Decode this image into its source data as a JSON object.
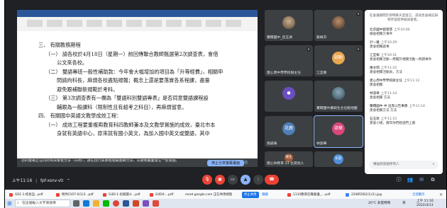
{
  "presentation": {
    "doc_lines": [
      "三、 有關教務期程",
      "（一） 請各校於4月18日（星期一）前回傳聯合教師甄選第2次調查表，會借",
      "公文來各校。",
      "（二） 雙語專班一般性補助款：今年會大幅增加的項目為「升等經費」，相關申",
      "問請向科長，麻煩各校盡點規報；概念上還是要落實各系程課，盡量",
      "避免跟補聯新規範於考科。",
      "（三） 第3次調查表有一欄為「雙語科別雙語專表」是否同意雙語課程設",
      "輔跟為一般課科（限制性且有超考之科目），再麻煩留意。",
      "四、 有關國中英語文教學成效工程：",
      "（一） 成效工程要重複兩教育科四教師兼本及文教學實施的成效，臺北市本",
      "身就有英語中心，原來就有國小英文，為加入國中英文或雙語，其中"
    ],
    "share_message": "您的螢幕正在向所有與會者分享（共用），請在自行與會者隱藏螢幕分享，以避免畫面發生一些漫遊。",
    "stop_sharing_label": "停止分享螢幕畫面",
    "hide_label": "略過"
  },
  "tiles": [
    {
      "name": "實踐國中_呂玉清",
      "kind": "photo",
      "color": "#5a6b4f"
    },
    {
      "name": "蔡綺芬",
      "kind": "photo",
      "color": "#6b4f3b"
    },
    {
      "name": "",
      "kind": "photo",
      "color": "#4c6a7a"
    },
    {
      "name": "建心周中學學校辦主任",
      "kind": "dark",
      "color": "#3c4043"
    },
    {
      "name": "江宜鄰",
      "kind": "avatar",
      "avatar": "啟動",
      "color": "#e8a64f"
    },
    {
      "name": "林誠佩",
      "kind": "photo",
      "color": "#7a5a4a"
    },
    {
      "name": "",
      "kind": "avatar",
      "avatar": "●",
      "color": "#6b4fbf"
    },
    {
      "name": "實踐國中業餘生主任組地圖",
      "kind": "dark",
      "color": "#3c4043"
    },
    {
      "name": "",
      "kind": "photo",
      "color": "#2f6d8c"
    },
    {
      "name": "張誠烽",
      "kind": "avatar",
      "avatar": "花鹿",
      "color": "#4f7fb8"
    },
    {
      "name": "林淑華",
      "kind": "avatar",
      "avatar": "淑華",
      "color": "#d9467a"
    },
    {
      "name": "",
      "kind": "photo",
      "color": "#5f4a7a"
    },
    {
      "name": "建心你教育 23 位其他人",
      "kind": "dark",
      "avatar": "陳生",
      "color": "#3c4043"
    },
    {
      "name": "",
      "kind": "avatar",
      "avatar": "彩庭",
      "color": "#4f8fd9"
    }
  ],
  "chat": {
    "header": "在會議期間於即時聊天室發言，該訊息會被記錄保存並提供給與會者。",
    "messages": [
      {
        "who": "北京國中劉蓉芸",
        "time": "上午10:00",
        "text": "總會相關方事件"
      },
      {
        "who": "計一雞",
        "time": "上午10:29",
        "text": "建會相關處事"
      },
      {
        "who": "江宜鄰",
        "time": "上午10:31",
        "text": "建會相關活動—用關於相關活動一問題事件"
      },
      {
        "who": "陳文閏",
        "time": "上午11:10",
        "text": "建會相關活動表，方法"
      },
      {
        "who": "建心周中學學校辦主任",
        "time": "上午11:12",
        "text": "建會相關"
      },
      {
        "who": "林淑華",
        "time": "上午11:14",
        "text": "建會相關 方法"
      },
      {
        "who": "實踐國中 中 出席公告事務",
        "time": "上午11:14",
        "text": "建會相關方法 方法"
      },
      {
        "who": "石玉玫",
        "time": "上午11:15",
        "text": "建會小組，兩年你們經過們上最"
      }
    ],
    "send_placeholder": "傳送訊息給所有人"
  },
  "controls": {
    "time": "上午11:16",
    "meeting_code": "fpf-xsnv-vti"
  },
  "downloads": [
    {
      "label": "G01-1-校長自...pdf"
    },
    {
      "label": "附件2107-0(1)3...pdf"
    },
    {
      "label": "G4D-1-比較圖十...pdf"
    },
    {
      "label": "G4D4-...pdf"
    },
    {
      "label": "meet.google.com 正在共用視窗"
    },
    {
      "label": "停止共用"
    },
    {
      "label": "隱藏"
    },
    {
      "label": "1110教育在職會議_....pdf"
    },
    {
      "label": "22085562(1)(1).jpg"
    }
  ],
  "downloads_show_all": "全部顯示",
  "taskbar": {
    "search_placeholder": "在這裡輸入文字來搜尋",
    "weather": "20°C 多雲時晴",
    "clock_time": "上午 11:16",
    "clock_date": "2022/4/13",
    "lang": "英"
  },
  "colors": {
    "meet_bg": "#202124",
    "accent": "#8ab4f8",
    "end_call": "#ea4335"
  }
}
